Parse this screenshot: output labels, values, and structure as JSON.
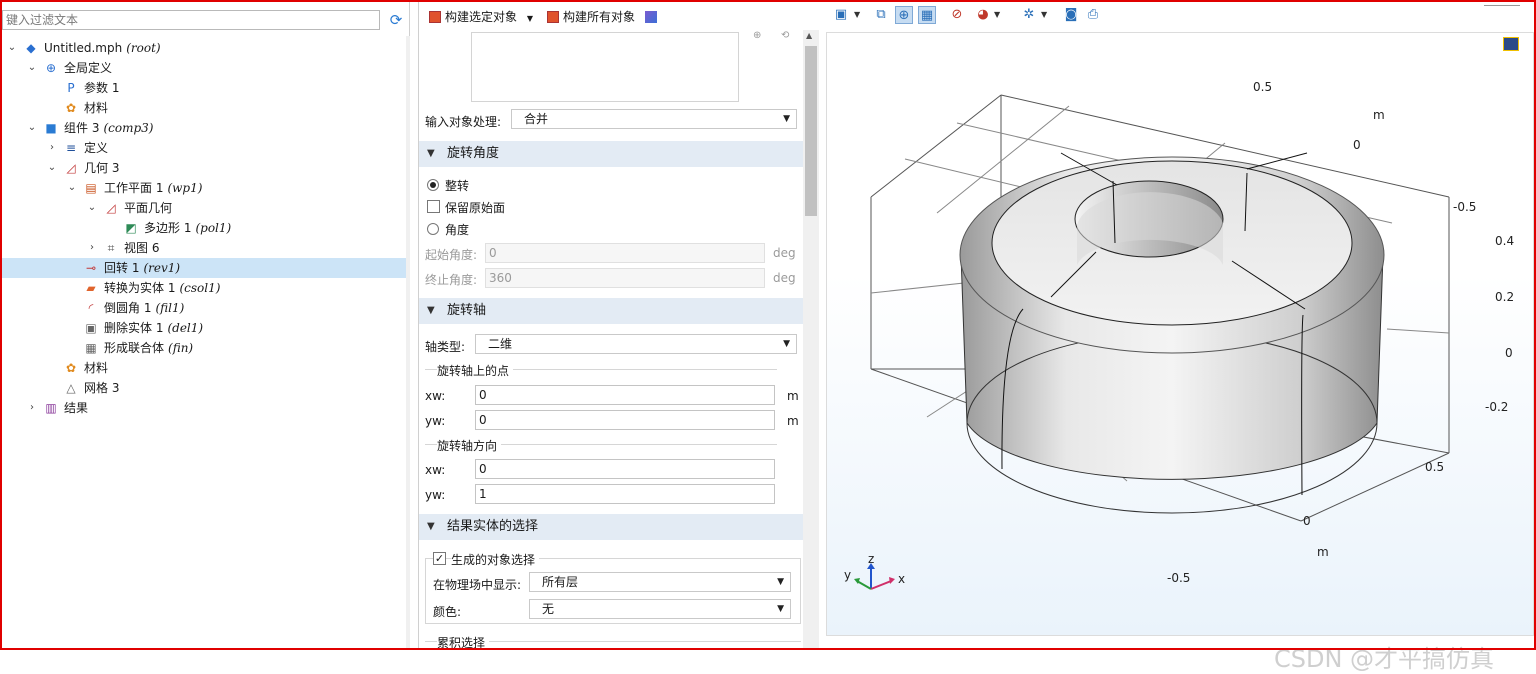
{
  "filter": {
    "placeholder": "键入过滤文本"
  },
  "tree": [
    {
      "label": "Untitled.mph",
      "tag": "(root)",
      "icon": "file-icon"
    },
    {
      "label": "全局定义",
      "tag": "",
      "icon": "globe-icon"
    },
    {
      "label": "参数 1",
      "tag": "",
      "icon": "parameter-icon"
    },
    {
      "label": "材料",
      "tag": "",
      "icon": "material-icon"
    },
    {
      "label": "组件 3",
      "tag": "(comp3)",
      "icon": "component-icon"
    },
    {
      "label": "定义",
      "tag": "",
      "icon": "definitions-icon"
    },
    {
      "label": "几何 3",
      "tag": "",
      "icon": "geometry-icon"
    },
    {
      "label": "工作平面 1",
      "tag": "(wp1)",
      "icon": "work-plane-icon"
    },
    {
      "label": "平面几何",
      "tag": "",
      "icon": "plane-geometry-icon"
    },
    {
      "label": "多边形 1",
      "tag": "(pol1)",
      "icon": "polygon-icon"
    },
    {
      "label": "视图 6",
      "tag": "",
      "icon": "view-icon"
    },
    {
      "label": "回转 1",
      "tag": "(rev1)",
      "icon": "revolve-icon"
    },
    {
      "label": "转换为实体 1",
      "tag": "(csol1)",
      "icon": "convert-solid-icon"
    },
    {
      "label": "倒圆角 1",
      "tag": "(fil1)",
      "icon": "fillet-icon"
    },
    {
      "label": "删除实体 1",
      "tag": "(del1)",
      "icon": "delete-entities-icon"
    },
    {
      "label": "形成联合体",
      "tag": "(fin)",
      "icon": "form-union-icon"
    },
    {
      "label": "材料",
      "tag": "",
      "icon": "material-icon"
    },
    {
      "label": "网格 3",
      "tag": "",
      "icon": "mesh-icon"
    },
    {
      "label": "结果",
      "tag": "",
      "icon": "results-icon"
    }
  ],
  "settings": {
    "toolbar": {
      "build_selected": "构建选定对象",
      "build_all": "构建所有对象"
    },
    "input_handling": {
      "label": "输入对象处理:",
      "value": "合并"
    },
    "angle_section": {
      "title": "旋转角度",
      "full": "整转",
      "keep_faces": "保留原始面",
      "angles": "角度",
      "start_label": "起始角度:",
      "start_value": "0",
      "start_unit": "deg",
      "end_label": "终止角度:",
      "end_value": "360",
      "end_unit": "deg"
    },
    "axis_section": {
      "title": "旋转轴",
      "axis_type_label": "轴类型:",
      "axis_type_value": "二维",
      "point_group": "旋转轴上的点",
      "point_xw_label": "xw:",
      "point_xw": "0",
      "point_xw_unit": "m",
      "point_yw_label": "yw:",
      "point_yw": "0",
      "point_yw_unit": "m",
      "direction_group": "旋转轴方向",
      "dir_xw_label": "xw:",
      "dir_xw": "0",
      "dir_yw_label": "yw:",
      "dir_yw": "1"
    },
    "selection_section": {
      "title": "结果实体的选择",
      "create_selection": "生成的对象选择",
      "show_in_physics_label": "在物理场中显示:",
      "show_in_physics_value": "所有层",
      "color_label": "颜色:",
      "color_value": "无",
      "cumulative": "累积选择"
    }
  },
  "graphics": {
    "axis_ticks": {
      "top_right": [
        "0.5",
        "0",
        "-0.5"
      ],
      "top_unit": "m",
      "z": [
        "0.4",
        "0.2",
        "0",
        "-0.2"
      ],
      "bottom": [
        "0.5",
        "0",
        "-0.5"
      ],
      "bottom_unit": "m"
    },
    "triad": {
      "x": "x",
      "y": "y",
      "z": "z"
    },
    "watermark": "CSDN @才平搞仿真"
  }
}
